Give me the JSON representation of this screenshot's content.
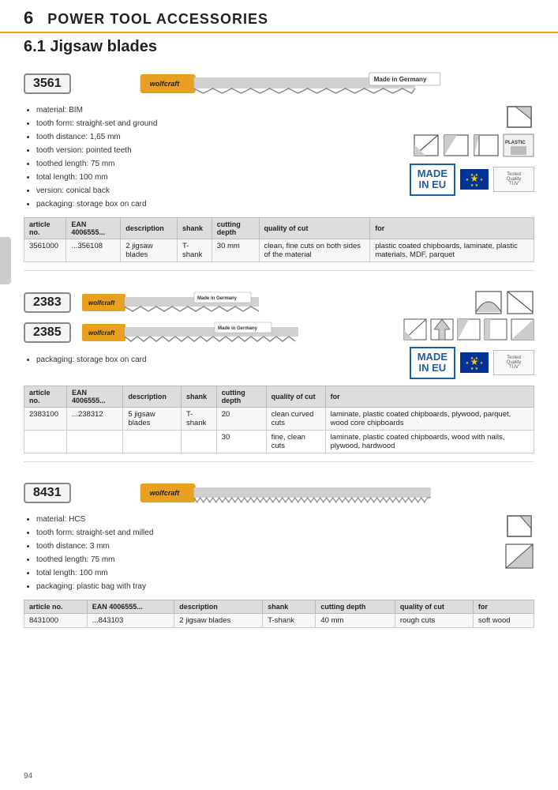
{
  "page": {
    "number": "94",
    "chapter_num": "6",
    "chapter_title": "POWER TOOL ACCESSORIES",
    "section_title": "6.1 Jigsaw blades"
  },
  "products": [
    {
      "id": "3561",
      "made_in": "Made in Germany",
      "specs": [
        "material: BIM",
        "tooth form: straight-set and ground",
        "tooth distance: 1,65 mm",
        "tooth version: pointed teeth",
        "toothed length: 75 mm",
        "total length: 100 mm",
        "version: conical back",
        "packaging: storage box on card"
      ],
      "table": {
        "headers": [
          "article no.",
          "EAN 4006555...",
          "description",
          "shank",
          "cutting depth",
          "quality of cut",
          "for"
        ],
        "rows": [
          {
            "article_no": "3561000",
            "ean": "...356108",
            "description": "2 jigsaw blades",
            "shank": "T-shank",
            "cutting_depth": "30 mm",
            "quality_of_cut": "clean, fine cuts on both sides of the material",
            "for": "plastic coated chipboards, laminate, plastic materials, MDF, parquet"
          }
        ]
      },
      "icons": {
        "top_row": [
          "corner-cut-icon"
        ],
        "mid_row": [
          "diagonal-cut-icon",
          "angle-cut-icon",
          "fine-cut-icon",
          "plastic-icon"
        ],
        "made_in_eu": true,
        "tuv": true
      }
    },
    {
      "id": "2383",
      "id2": "2385",
      "made_in": "Made in Germany",
      "specs_shared": [
        "packaging: storage box on card"
      ],
      "table": {
        "headers": [
          "article no.",
          "EAN 4006555...",
          "description",
          "shank",
          "cutting depth",
          "quality of cut",
          "for"
        ],
        "rows": [
          {
            "article_no": "2383100",
            "ean": "...238312",
            "description": "5 jigsaw blades",
            "shank": "T-shank",
            "cutting_depth": "20",
            "quality_of_cut": "clean curved cuts",
            "for": "laminate, plastic coated chipboards, plywood, parquet, wood core chipboards"
          },
          {
            "article_no": "",
            "ean": "",
            "description": "",
            "shank": "",
            "cutting_depth": "30",
            "quality_of_cut": "fine, clean cuts",
            "for": "laminate, plastic coated chipboards, wood with nails, plywood, hardwood"
          }
        ]
      },
      "icons": {
        "top_row": [
          "curve-cut-icon",
          "straight-cut-icon"
        ],
        "mid_row": [
          "diagonal-cut-icon",
          "arrow-cut-icon",
          "angle2-cut-icon",
          "fine2-cut-icon",
          "bevel-cut-icon"
        ],
        "made_in_eu": true,
        "tuv": true
      }
    },
    {
      "id": "8431",
      "specs": [
        "material: HCS",
        "tooth form: straight-set and milled",
        "tooth distance: 3 mm",
        "toothed length: 75 mm",
        "total length: 100 mm",
        "packaging: plastic bag with tray"
      ],
      "table": {
        "headers": [
          "article no.",
          "EAN 4006555...",
          "description",
          "shank",
          "cutting depth",
          "quality of cut",
          "for"
        ],
        "rows": [
          {
            "article_no": "8431000",
            "ean": "...843103",
            "description": "2 jigsaw blades",
            "shank": "T-shank",
            "cutting_depth": "40 mm",
            "quality_of_cut": "rough cuts",
            "for": "soft wood"
          }
        ]
      },
      "icons": {
        "top_row": [
          "corner-cut-icon2"
        ],
        "mid_row": [
          "bevel2-cut-icon"
        ],
        "made_in_eu": false,
        "tuv": false
      }
    }
  ]
}
